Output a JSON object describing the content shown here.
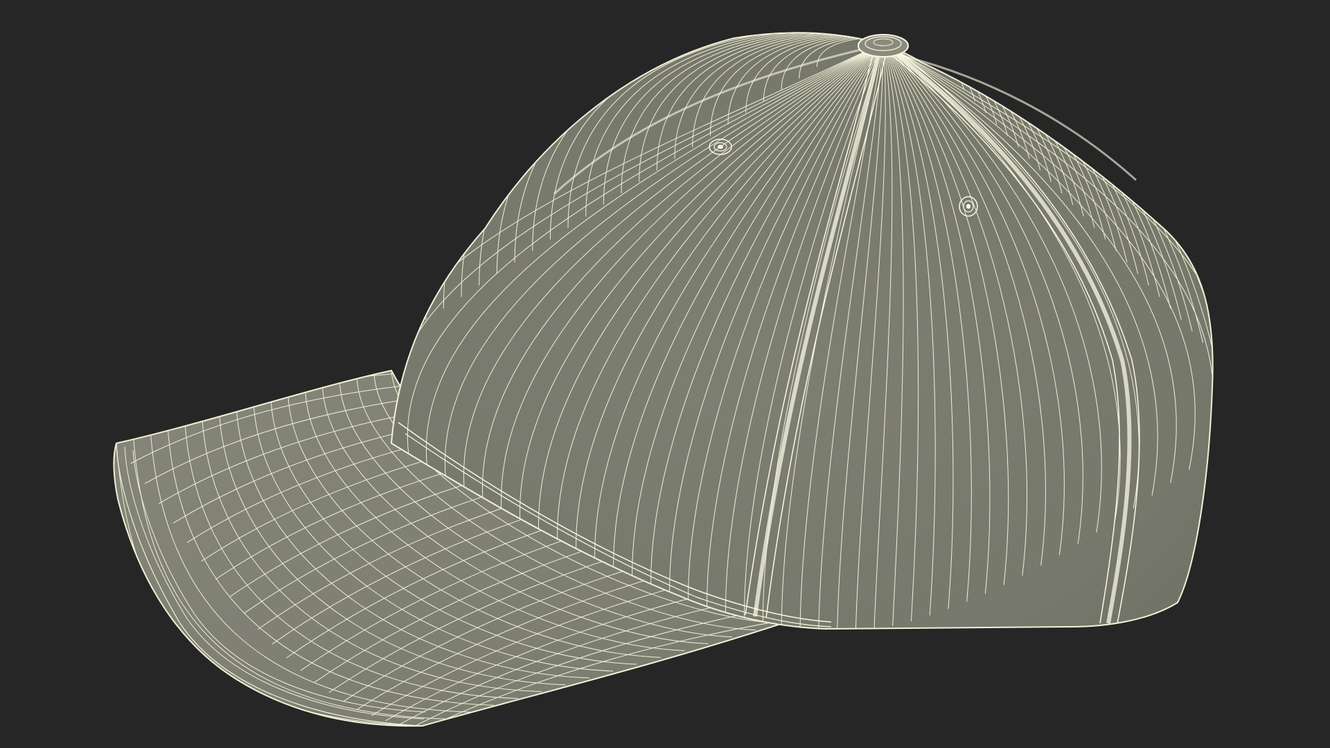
{
  "scene": {
    "subject": "baseball-cap-wireframe",
    "colors": {
      "background": "#262626",
      "surface": "#7b7c70",
      "surface_light": "#878879",
      "surface_dark": "#6e6f63",
      "wire": "#f2f1d8",
      "seam": "#fbfae6"
    }
  }
}
